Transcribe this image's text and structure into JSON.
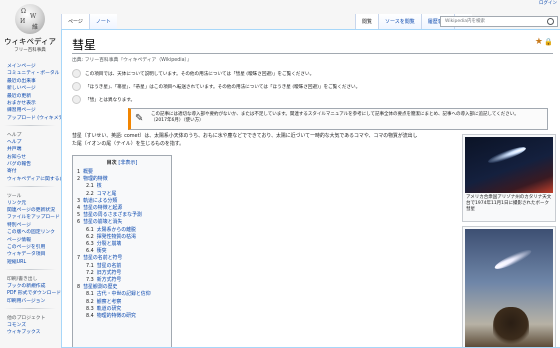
{
  "logo": {
    "title": "ウィキペディア",
    "subtitle": "フリー百科事典"
  },
  "personal": {
    "login": "ログイン"
  },
  "tabs": {
    "page": "ページ",
    "talk": "ノート",
    "read": "閲覧",
    "edit_source": "ソースを閲覧",
    "history": "履歴表示",
    "more": "…"
  },
  "search": {
    "placeholder": "Wikipedia内を検索"
  },
  "sidebar": {
    "main_items": [
      "メインページ",
      "コミュニティ・ポータル",
      "最近の出来事",
      "新しいページ",
      "最近の更新",
      "おまかせ表示",
      "練習用ページ",
      "アップロード (ウィキメディア・コモンズ)"
    ],
    "help_heading": "ヘルプ",
    "help_items": [
      "ヘルプ",
      "井戸端",
      "お知らせ",
      "バグの報告",
      "寄付",
      "ウィキペディアに関するお問い合わせ"
    ],
    "tools_heading": "ツール",
    "tools_items": [
      "リンク元",
      "関連ページの更新状況",
      "ファイルをアップロード",
      "特別ページ",
      "この版への固定リンク",
      "ページ情報",
      "このページを引用",
      "ウィキデータ項目",
      "短縮URL"
    ],
    "print_heading": "印刷/書き出し",
    "print_items": [
      "ブックの新規作成",
      "PDF 形式でダウンロード",
      "印刷用バージョン"
    ],
    "other_heading": "他のプロジェクト",
    "other_items": [
      "コモンズ",
      "ウィキブックス"
    ]
  },
  "article": {
    "title": "彗星",
    "site_sub": "出典: フリー百科事典『ウィキペディア（Wikipedia）』",
    "hatnotes": [
      "この項目では、天体について説明しています。その他の用法については「彗星 (曖昧さ回避)」をご覧ください。",
      "「ほうき星」、「箒星」、「帚星」はこの項目へ転送されています。その他の用法については「ほうき星 (曖昧さ回避)」をご覧ください。",
      "「彗」とは異なります。"
    ],
    "ambox_line1": "この記事には適切な導入部や要約がないか、または不足しています。関連するスタイルマニュアルを参考にして記事全体の要点を簡潔にまとめ、記事への導入部に追記してください。",
    "ambox_line2": "（2017年6月）（使い方）",
    "lead_line1": "彗星（すいせい、英語: comet）は、太陽系小天体のうち、おもに氷や塵などでできており、太陽に近づいて一時的な大気であるコマや、コマの物質が流出し",
    "lead_line2": "た尾（イオンの尾（テイル）を生じるものを指す。"
  },
  "toc": {
    "title": "目次",
    "hide": "[非表示]",
    "items": [
      {
        "num": "1",
        "label": "概要",
        "level": 1
      },
      {
        "num": "2",
        "label": "物理的特徴",
        "level": 1
      },
      {
        "num": "2.1",
        "label": "核",
        "level": 2
      },
      {
        "num": "2.2",
        "label": "コマと尾",
        "level": 2
      },
      {
        "num": "3",
        "label": "軌道による分類",
        "level": 1
      },
      {
        "num": "4",
        "label": "彗星の特徴と起源",
        "level": 1
      },
      {
        "num": "5",
        "label": "彗星の周るさまざまな予測",
        "level": 1
      },
      {
        "num": "6",
        "label": "彗星の崩壊と消失",
        "level": 1
      },
      {
        "num": "6.1",
        "label": "太陽系からの離脱",
        "level": 2
      },
      {
        "num": "6.2",
        "label": "揮発性物質の枯渇",
        "level": 2
      },
      {
        "num": "6.3",
        "label": "分裂と崩壊",
        "level": 2
      },
      {
        "num": "6.4",
        "label": "衝突",
        "level": 2
      },
      {
        "num": "7",
        "label": "彗星の名前と符号",
        "level": 1
      },
      {
        "num": "7.1",
        "label": "彗星の名前",
        "level": 2
      },
      {
        "num": "7.2",
        "label": "旧方式符号",
        "level": 2
      },
      {
        "num": "7.3",
        "label": "新方式符号",
        "level": 2
      },
      {
        "num": "8",
        "label": "彗星観測の歴史",
        "level": 1
      },
      {
        "num": "8.1",
        "label": "古代・中世の記録と信仰",
        "level": 2
      },
      {
        "num": "8.2",
        "label": "観察と考察",
        "level": 2
      },
      {
        "num": "8.3",
        "label": "軌道の研究",
        "level": 2
      },
      {
        "num": "8.4",
        "label": "物理的特徴の研究",
        "level": 2
      }
    ]
  },
  "thumb1": {
    "caption": "アメリカ合衆国アリゾナ州のカタリナ天文台で1974年11月1日に撮影されたボーク彗星"
  }
}
